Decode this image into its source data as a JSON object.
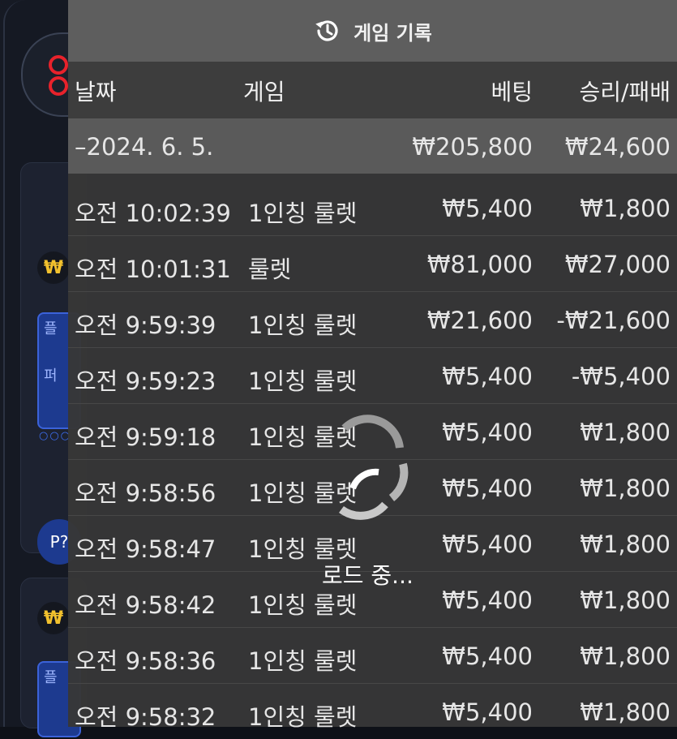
{
  "panel": {
    "title": "게임 기록",
    "columns": {
      "date": "날짜",
      "game": "게임",
      "bet": "베팅",
      "winloss": "승리/패배"
    }
  },
  "summary": {
    "date": "–2024. 6. 5.",
    "bet": "₩205,800",
    "winloss": "₩24,600"
  },
  "rows": [
    {
      "time": "오전 10:02:39",
      "game": "1인칭 룰렛",
      "bet": "₩5,400",
      "winloss": "₩1,800"
    },
    {
      "time": "오전 10:01:31",
      "game": "룰렛",
      "bet": "₩81,000",
      "winloss": "₩27,000"
    },
    {
      "time": "오전 9:59:39",
      "game": "1인칭 룰렛",
      "bet": "₩21,600",
      "winloss": "-₩21,600"
    },
    {
      "time": "오전 9:59:23",
      "game": "1인칭 룰렛",
      "bet": "₩5,400",
      "winloss": "-₩5,400"
    },
    {
      "time": "오전 9:59:18",
      "game": "1인칭 룰렛",
      "bet": "₩5,400",
      "winloss": "₩1,800"
    },
    {
      "time": "오전 9:58:56",
      "game": "1인칭 룰렛",
      "bet": "₩5,400",
      "winloss": "₩1,800"
    },
    {
      "time": "오전 9:58:47",
      "game": "1인칭 룰렛",
      "bet": "₩5,400",
      "winloss": "₩1,800"
    },
    {
      "time": "오전 9:58:42",
      "game": "1인칭 룰렛",
      "bet": "₩5,400",
      "winloss": "₩1,800"
    },
    {
      "time": "오전 9:58:36",
      "game": "1인칭 룰렛",
      "bet": "₩5,400",
      "winloss": "₩1,800"
    },
    {
      "time": "오전 9:58:32",
      "game": "1인칭 룰렛",
      "bet": "₩5,400",
      "winloss": "₩1,800"
    }
  ],
  "loading": {
    "text": "로드 중..."
  },
  "background": {
    "coin_symbol": "₩",
    "button_label_1": "플",
    "button_label_2": "퍼",
    "p_badge": "P?"
  },
  "icons": {
    "history": "history-icon",
    "spinner": "loading-spinner-icon"
  }
}
